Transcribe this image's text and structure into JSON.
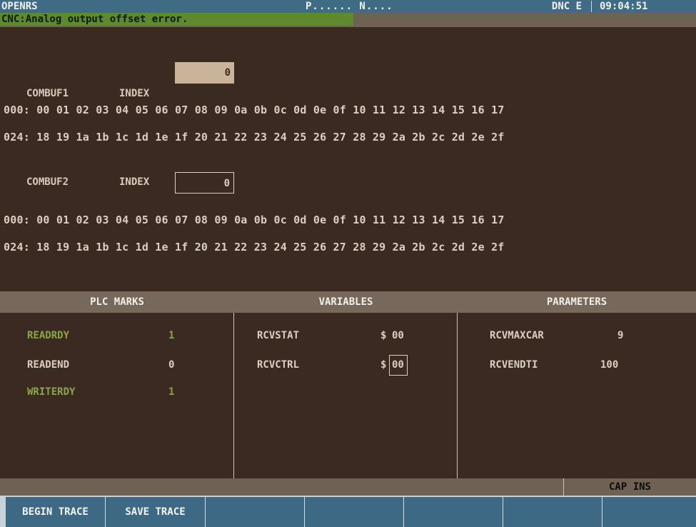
{
  "header": {
    "app_title": "OPENRS",
    "program": "P...... N....",
    "mode": "DNC E",
    "time": "09:04:51"
  },
  "message": {
    "text": "CNC:Analog output offset error."
  },
  "combuf1": {
    "label": "COMBUF1",
    "index_label": "INDEX",
    "index_value": "0",
    "rows": [
      "000: 00 01 02 03 04 05 06 07 08 09 0a 0b 0c 0d 0e 0f 10 11 12 13 14 15 16 17",
      "024: 18 19 1a 1b 1c 1d 1e 1f 20 21 22 23 24 25 26 27 28 29 2a 2b 2c 2d 2e 2f"
    ]
  },
  "combuf2": {
    "label": "COMBUF2",
    "index_label": "INDEX",
    "index_value": "0",
    "rows": [
      "000: 00 01 02 03 04 05 06 07 08 09 0a 0b 0c 0d 0e 0f 10 11 12 13 14 15 16 17",
      "024: 18 19 1a 1b 1c 1d 1e 1f 20 21 22 23 24 25 26 27 28 29 2a 2b 2c 2d 2e 2f"
    ]
  },
  "panels": {
    "plc": {
      "title": "PLC MARKS",
      "items": [
        {
          "name": "READRDY",
          "value": "1",
          "active": true
        },
        {
          "name": "READEND",
          "value": "0",
          "active": false
        },
        {
          "name": "WRITERDY",
          "value": "1",
          "active": true
        }
      ]
    },
    "variables": {
      "title": "VARIABLES",
      "items": [
        {
          "name": "RCVSTAT",
          "prefix": "$",
          "value": "00"
        },
        {
          "name": "RCVCTRL",
          "prefix": "$",
          "value": "00"
        }
      ]
    },
    "parameters": {
      "title": "PARAMETERS",
      "items": [
        {
          "name": "RCVMAXCAR",
          "value": "9"
        },
        {
          "name": "RCVENDTI",
          "value": "100"
        }
      ]
    }
  },
  "status": {
    "caps": "CAP INS"
  },
  "softkeys": [
    "BEGIN TRACE",
    "SAVE TRACE",
    "",
    "",
    "",
    "",
    ""
  ],
  "colors": {
    "background": "#3b2a21",
    "header_bar": "#3f6c84",
    "error_message": "#5d8a2f",
    "active_mark": "#8ba646",
    "panel_header": "#76685a"
  }
}
